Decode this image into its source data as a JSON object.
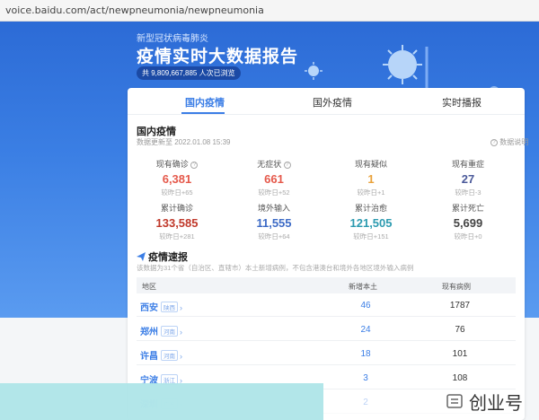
{
  "browser": {
    "url": "voice.baidu.com/act/newpneumonia/newpneumonia"
  },
  "header": {
    "subtitle": "新型冠状病毒肺炎",
    "title": "疫情实时大数据报告",
    "views": "共 9,809,667,885 人次已浏览"
  },
  "tabs": [
    "国内疫情",
    "国外疫情",
    "实时播报"
  ],
  "domestic": {
    "title": "国内疫情",
    "update_time": "数据更新至 2022.01.08 15:39",
    "data_note": "数据说明",
    "stats": [
      {
        "label": "现有确诊",
        "value": "6,381",
        "delta": "较昨日+65",
        "color": "#e5594b",
        "info": "?"
      },
      {
        "label": "无症状",
        "value": "661",
        "delta": "较昨日+52",
        "color": "#e5594b",
        "info": "?"
      },
      {
        "label": "现有疑似",
        "value": "1",
        "delta": "较昨日+1",
        "color": "#e9a23b",
        "info": ""
      },
      {
        "label": "现有重症",
        "value": "27",
        "delta": "较昨日-3",
        "color": "#4b5a9a",
        "info": ""
      },
      {
        "label": "累计确诊",
        "value": "133,585",
        "delta": "较昨日+281",
        "color": "#c0392b",
        "info": ""
      },
      {
        "label": "境外输入",
        "value": "11,555",
        "delta": "较昨日+64",
        "color": "#3d6bc6",
        "info": ""
      },
      {
        "label": "累计治愈",
        "value": "121,505",
        "delta": "较昨日+151",
        "color": "#2d9bb0",
        "info": ""
      },
      {
        "label": "累计死亡",
        "value": "5,699",
        "delta": "较昨日+0",
        "color": "#444444",
        "info": ""
      }
    ]
  },
  "news": {
    "title": "疫情速报",
    "desc": "该数据为31个省（自治区、直辖市）本土新增病例，不包含港澳台和境外各地区境外输入病例",
    "columns": [
      "地区",
      "新增本土",
      "现有病例"
    ],
    "rows": [
      {
        "city": "西安",
        "province": "陕西",
        "new": "46",
        "current": "1787"
      },
      {
        "city": "郑州",
        "province": "河南",
        "new": "24",
        "current": "76"
      },
      {
        "city": "许昌",
        "province": "河南",
        "new": "18",
        "current": "101"
      },
      {
        "city": "宁波",
        "province": "浙江",
        "new": "3",
        "current": "108"
      },
      {
        "city": "深圳",
        "province": "广东",
        "new": "2",
        "current": ""
      }
    ]
  },
  "watermark": {
    "text": "创业号",
    "logo": "toutiao-logo-icon"
  },
  "colors": {
    "accent": "#3b7ee6",
    "banner": "#3b7fe4"
  }
}
